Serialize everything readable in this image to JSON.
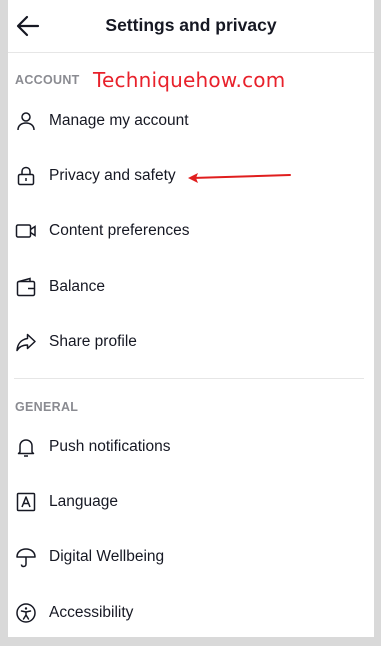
{
  "header": {
    "title": "Settings and privacy",
    "back_icon": "arrow-left-icon"
  },
  "watermark": "Techniquehow.com",
  "colors": {
    "watermark": "#e8212b",
    "annotation_arrow": "#e01e1e",
    "section_label": "#8a8b91",
    "text": "#161823"
  },
  "account": {
    "label": "ACCOUNT",
    "items": [
      {
        "label": "Manage my account",
        "icon": "person-icon"
      },
      {
        "label": "Privacy and safety",
        "icon": "lock-icon"
      },
      {
        "label": "Content preferences",
        "icon": "video-icon"
      },
      {
        "label": "Balance",
        "icon": "wallet-icon"
      },
      {
        "label": "Share profile",
        "icon": "share-icon"
      }
    ]
  },
  "general": {
    "label": "GENERAL",
    "items": [
      {
        "label": "Push notifications",
        "icon": "bell-icon"
      },
      {
        "label": "Language",
        "icon": "language-icon"
      },
      {
        "label": "Digital Wellbeing",
        "icon": "umbrella-icon"
      },
      {
        "label": "Accessibility",
        "icon": "accessibility-icon"
      }
    ]
  }
}
